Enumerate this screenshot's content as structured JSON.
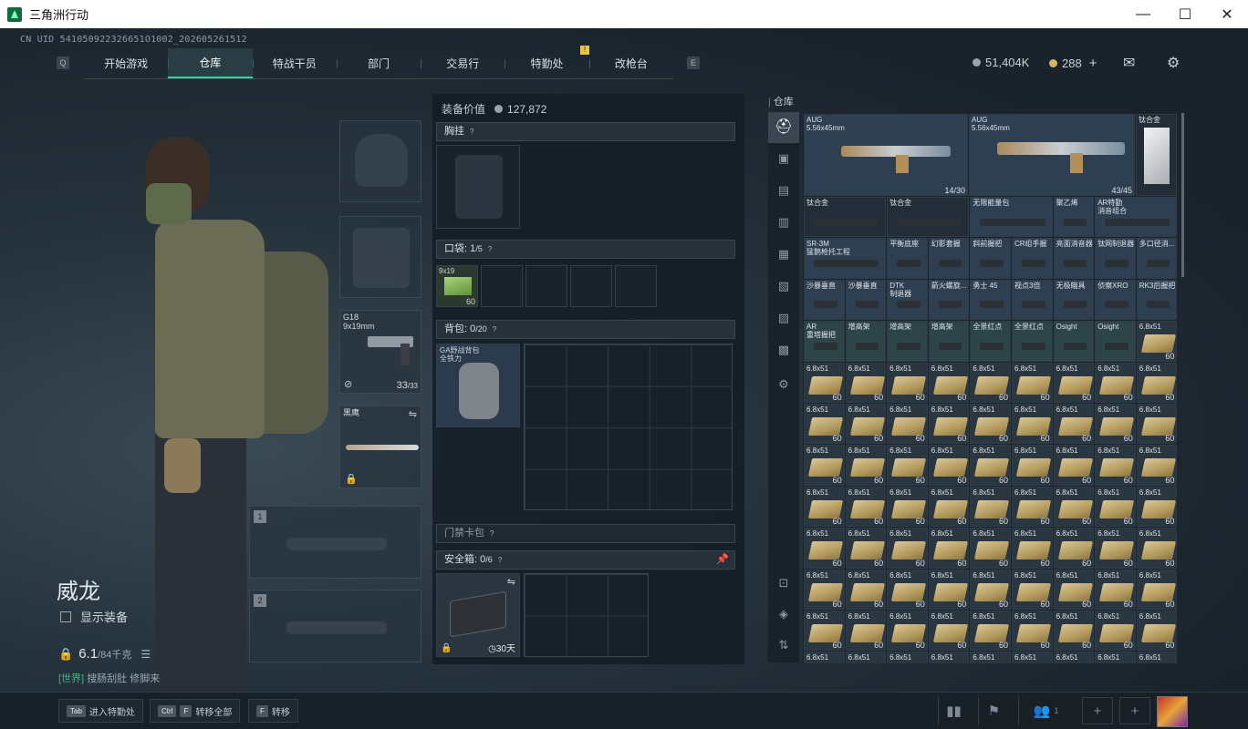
{
  "window": {
    "title": "三角洲行动",
    "controls": [
      "—",
      "☐",
      "✕"
    ]
  },
  "uid": "CN UID 541050922326651O1002_202605261512",
  "nav": {
    "left_key": "Q",
    "right_key": "E",
    "tabs": [
      {
        "label": "开始游戏"
      },
      {
        "label": "仓库"
      },
      {
        "label": "特战干员"
      },
      {
        "label": "部门"
      },
      {
        "label": "交易行"
      },
      {
        "label": "特勤处"
      },
      {
        "label": "改枪台"
      }
    ],
    "notice_badge": "!"
  },
  "currency": {
    "silver": "51,404K",
    "gold": "288",
    "gold_add": "+"
  },
  "operator": {
    "name": "威龙",
    "show_gear_label": "显示装备",
    "weight_value": "6.1",
    "weight_capacity": "/84千克",
    "chat_channel": "[世界]",
    "chat_text": "搜肠刮肚 修脚来"
  },
  "equipment_slots": {
    "pistol": {
      "name": "G18",
      "ammo": "9x19mm",
      "count": "33",
      "max": "/33"
    },
    "melee": {
      "name": "黑鹰"
    },
    "primary_1": "1",
    "primary_2": "2"
  },
  "gear_panel": {
    "value_label": "装备价值",
    "value": "127,872",
    "chest_label": "胸挂",
    "pocket_label": "口袋",
    "pocket_count": "1",
    "pocket_max": "/5",
    "pocket_item": {
      "name": "9x19",
      "count": "60"
    },
    "backpack_label": "背包",
    "backpack_count": "0",
    "backpack_max": "/20",
    "backpack_item": "GA野战背包\n全铁力",
    "keycard_label": "门禁卡包",
    "safebox_label": "安全箱",
    "safebox_count": "0",
    "safebox_max": "/6",
    "safebox_time": "30天",
    "help": "?"
  },
  "stash": {
    "title": "仓库",
    "row1": [
      {
        "name": "AUG\n5.56x45mm",
        "count": "14/30"
      },
      {
        "name": "AUG\n5.56x45mm",
        "count": "43/45"
      },
      {
        "name": "钛合金"
      }
    ],
    "row2": [
      {
        "name": "钛合金"
      },
      {
        "name": "钛合金"
      },
      {
        "name": "无限能量包"
      },
      {
        "name": "聚乙烯"
      },
      {
        "name": "AR特勤\n消音组合"
      }
    ],
    "row3": [
      {
        "name": "SR-3M\n猛鹅枪托工程"
      },
      {
        "name": "平衡底座"
      },
      {
        "name": "幻影套握"
      },
      {
        "name": "斜前握把"
      },
      {
        "name": "CR组手握"
      },
      {
        "name": "亮面消音器"
      },
      {
        "name": "钛网制退器"
      },
      {
        "name": "多口径消..."
      }
    ],
    "row4": [
      {
        "name": "沙暴垂直"
      },
      {
        "name": "沙暴垂直"
      },
      {
        "name": "DTK\n制退器"
      },
      {
        "name": "箭火螺旋..."
      },
      {
        "name": "勇士 45"
      },
      {
        "name": "视点3倍"
      },
      {
        "name": "无极瞄具"
      },
      {
        "name": "侦察XRO"
      },
      {
        "name": "RK3后握把"
      }
    ],
    "row5": [
      {
        "name": "AR\n重塔握把"
      },
      {
        "name": "增高架"
      },
      {
        "name": "增高架"
      },
      {
        "name": "增高架"
      },
      {
        "name": "全景红点"
      },
      {
        "name": "全景红点"
      },
      {
        "name": "Osight"
      },
      {
        "name": "Osight"
      },
      {
        "name": "6.8x51",
        "count": "60"
      }
    ],
    "ammo_label": "6.8x51",
    "ammo_count": "60",
    "sidebar_icons": [
      "helmet-icon",
      "armor-icon",
      "weapon-icon",
      "ammo-icon",
      "medical-icon",
      "container-icon",
      "key-icon",
      "material-icon",
      "gear-settings-icon"
    ]
  },
  "bottom": {
    "tab_key": "Tab",
    "tab_label": "进入特勤处",
    "ctrl_key": "Ctrl",
    "f_key": "F",
    "transfer_all": "转移全部",
    "transfer": "转移",
    "squad_count": "1"
  },
  "colors": {
    "accent": "#37d39a",
    "panel": "#1b252e",
    "gold": "#d4b56a"
  }
}
